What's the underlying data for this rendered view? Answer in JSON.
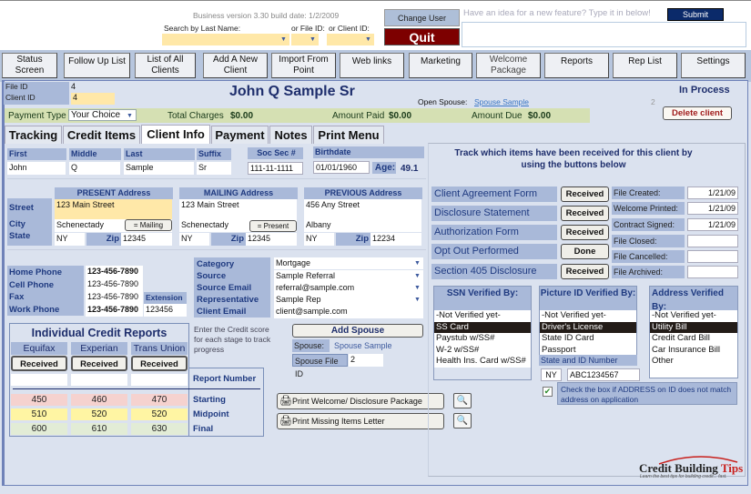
{
  "header": {
    "version": "Business version 3.30  build date: 1/2/2009",
    "search_last_name_label": "Search by Last Name:",
    "file_id_label": "or File ID:",
    "client_id_label": "or Client ID:",
    "search_last_name_value": "",
    "file_id_value": "",
    "client_id_value": "",
    "change_user": "Change User",
    "quit": "Quit",
    "feature_prompt": "Have an idea for a new feature? Type it in below!",
    "submit": "Submit",
    "feature_value": ""
  },
  "nav": [
    {
      "label": "Status\nScreen"
    },
    {
      "label": "Follow Up List"
    },
    {
      "label": "List of All\nClients"
    },
    {
      "label": "Add A New\nClient"
    },
    {
      "label": "Import From\nPoint"
    },
    {
      "label": "Web links"
    },
    {
      "label": "Marketing"
    },
    {
      "label": "Welcome\nPackage"
    },
    {
      "label": "Reports"
    },
    {
      "label": "Rep List"
    },
    {
      "label": "Settings"
    }
  ],
  "record": {
    "file_id_label": "File ID",
    "file_id": "4",
    "client_id_label": "Client ID",
    "client_id": "4",
    "client_name": "John Q Sample Sr",
    "status": "In Process",
    "open_spouse_label": "Open Spouse:",
    "open_spouse_link": "Spouse Sample",
    "spouse_id_small": "2",
    "delete_client": "Delete client"
  },
  "payment_bar": {
    "payment_type_label": "Payment Type",
    "payment_type": "Your Choice",
    "total_charges_label": "Total Charges",
    "total_charges": "$0.00",
    "amount_paid_label": "Amount Paid",
    "amount_paid": "$0.00",
    "amount_due_label": "Amount Due",
    "amount_due": "$0.00"
  },
  "tabs": [
    {
      "label": "Tracking",
      "active": false
    },
    {
      "label": "Credit Items",
      "active": false
    },
    {
      "label": "Client Info",
      "active": true
    },
    {
      "label": "Payment",
      "active": false
    },
    {
      "label": "Notes",
      "active": false
    },
    {
      "label": "Print Menu",
      "active": false
    }
  ],
  "client": {
    "first_label": "First",
    "first": "John",
    "middle_label": "Middle",
    "middle": "Q",
    "last_label": "Last",
    "last": "Sample",
    "suffix_label": "Suffix",
    "suffix": "Sr",
    "ssn_label": "Soc Sec #",
    "ssn": "111-11-1111",
    "birthdate_label": "Birthdate",
    "birthdate": "01/01/1960",
    "age_label": "Age:",
    "age": "49.1"
  },
  "addresses": {
    "street_label": "Street",
    "city_label": "City",
    "state_label": "State",
    "zip_label": "Zip",
    "present": {
      "title": "PRESENT Address",
      "street": "123 Main Street",
      "city": "Schenectady",
      "state": "NY",
      "zip": "12345",
      "copy_button": "= Mailing"
    },
    "mailing": {
      "title": "MAILING Address",
      "street": "123 Main Street",
      "city": "Schenectady",
      "state": "NY",
      "zip": "12345",
      "copy_button": "= Present"
    },
    "previous": {
      "title": "PREVIOUS Address",
      "street": "456 Any Street",
      "city": "Albany",
      "state": "NY",
      "zip": "12234"
    }
  },
  "phones": {
    "home_label": "Home Phone",
    "home": "123-456-7890",
    "cell_label": "Cell Phone",
    "cell": "123-456-7890",
    "fax_label": "Fax",
    "fax": "123-456-7890",
    "work_label": "Work Phone",
    "work": "123-456-7890",
    "extension_label": "Extension",
    "extension": "123456"
  },
  "meta": {
    "category_label": "Category",
    "category": "Mortgage",
    "source_label": "Source",
    "source": "Sample Referral",
    "source_email_label": "Source Email",
    "source_email": "referral@sample.com",
    "rep_label": "Representative",
    "rep": "Sample Rep",
    "client_email_label": "Client Email",
    "client_email": "client@sample.com"
  },
  "tracking": {
    "message": "Track which items have been received for this client by using the buttons below",
    "items": [
      {
        "label": "Client Agreement Form",
        "button": "Received"
      },
      {
        "label": "Disclosure Statement",
        "button": "Received"
      },
      {
        "label": "Authorization Form",
        "button": "Received"
      },
      {
        "label": "Opt Out Performed",
        "button": "Done"
      },
      {
        "label": "Section 405 Disclosure",
        "button": "Received"
      }
    ],
    "dates": [
      {
        "label": "File Created:",
        "value": "1/21/09"
      },
      {
        "label": "Welcome Printed:",
        "value": "1/21/09"
      },
      {
        "label": "Contract Signed:",
        "value": "1/21/09"
      },
      {
        "label": "File Closed:",
        "value": ""
      },
      {
        "label": "File Cancelled:",
        "value": ""
      },
      {
        "label": "File Archived:",
        "value": ""
      }
    ]
  },
  "verification": {
    "ssn": {
      "title": "SSN Verified By:",
      "options": [
        "-Not Verified yet-",
        "SS Card",
        "Paystub w/SS#",
        "W-2 w/SS#",
        "Health Ins. Card w/SS#"
      ],
      "selected": "SS Card"
    },
    "picture": {
      "title": "Picture ID Verified By:",
      "options": [
        "-Not Verified yet-",
        "Driver's License",
        "State ID Card",
        "Passport"
      ],
      "selected": "Driver's License",
      "state_id_label": "State  and ID Number",
      "state": "NY",
      "id_number": "ABC1234567"
    },
    "address": {
      "title": "Address Verified By:",
      "options": [
        "-Not Verified yet-",
        "Utility Bill",
        "Credit Card Bill",
        "Car Insurance Bill",
        "Other"
      ],
      "selected": "Utility Bill"
    },
    "mismatch_checked": true,
    "mismatch_label": "Check the box if ADDRESS on ID does not match address on application"
  },
  "credit_reports": {
    "title": "Individual Credit Reports",
    "bureaus": [
      "Equifax",
      "Experian",
      "Trans Union"
    ],
    "received_label": "Received",
    "report_number_label": "Report Number",
    "hint": "Enter the Credit score for each stage to track progress",
    "stages": [
      {
        "label": "Starting",
        "scores": [
          "450",
          "460",
          "470"
        ],
        "color": "#f5d2cf"
      },
      {
        "label": "Midpoint",
        "scores": [
          "510",
          "520",
          "520"
        ],
        "color": "#fff5a3"
      },
      {
        "label": "Final",
        "scores": [
          "600",
          "610",
          "630"
        ],
        "color": "#e2ecd6"
      }
    ]
  },
  "spouse": {
    "add_button": "Add Spouse",
    "spouse_label": "Spouse:",
    "spouse_name": "Spouse Sample",
    "spouse_file_id_label": "Spouse File ID",
    "spouse_file_id": "2"
  },
  "print": {
    "welcome": "Print Welcome/ Disclosure Package",
    "missing": "Print Missing Items Letter"
  },
  "logo": {
    "text_a": "Credit Building ",
    "text_b": "Tips",
    "tagline": "Learn the best tips for building credit... fast."
  }
}
